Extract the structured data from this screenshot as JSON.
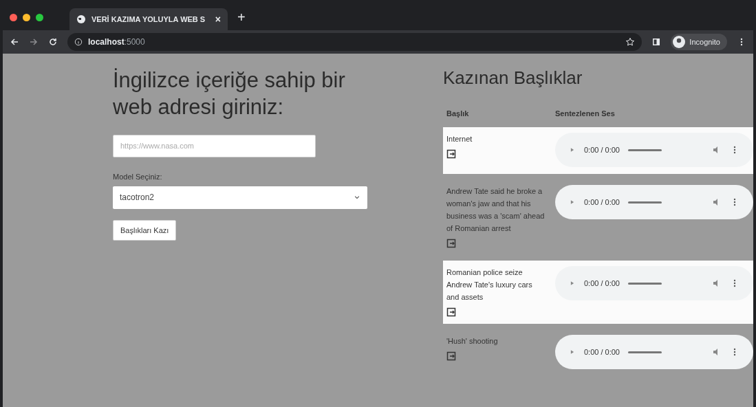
{
  "browser": {
    "tab_title": "VERİ KAZIMA YOLUYLA WEB S",
    "tab_close": "×",
    "new_tab": "+",
    "url_host": "localhost",
    "url_port": ":5000",
    "profile": "Incognito"
  },
  "form": {
    "heading": "İngilizce içeriğe sahip bir web adresi giriniz:",
    "url_field": {
      "placeholder": "https://www.nasa.com"
    },
    "model_label": "Model Seçiniz:",
    "model_select": "tacotron2",
    "submit": "Başlıkları Kazı"
  },
  "results": {
    "heading": "Kazınan Başlıklar",
    "columns": [
      "Başlık",
      "Sentezlenen Ses"
    ],
    "rows": [
      {
        "title": "Internet",
        "player": {
          "time": "0:00 / 0:00"
        }
      },
      {
        "title": "Andrew Tate said he broke a woman's jaw and that his business was a 'scam' ahead of Romanian arrest",
        "player": {
          "time": "0:00 / 0:00"
        }
      },
      {
        "title": "Romanian police seize Andrew Tate's luxury cars and assets",
        "player": {
          "time": "0:00 / 0:00"
        }
      },
      {
        "title": "'Hush' shooting",
        "player": {
          "time": "0:00 / 0:00"
        }
      }
    ]
  }
}
